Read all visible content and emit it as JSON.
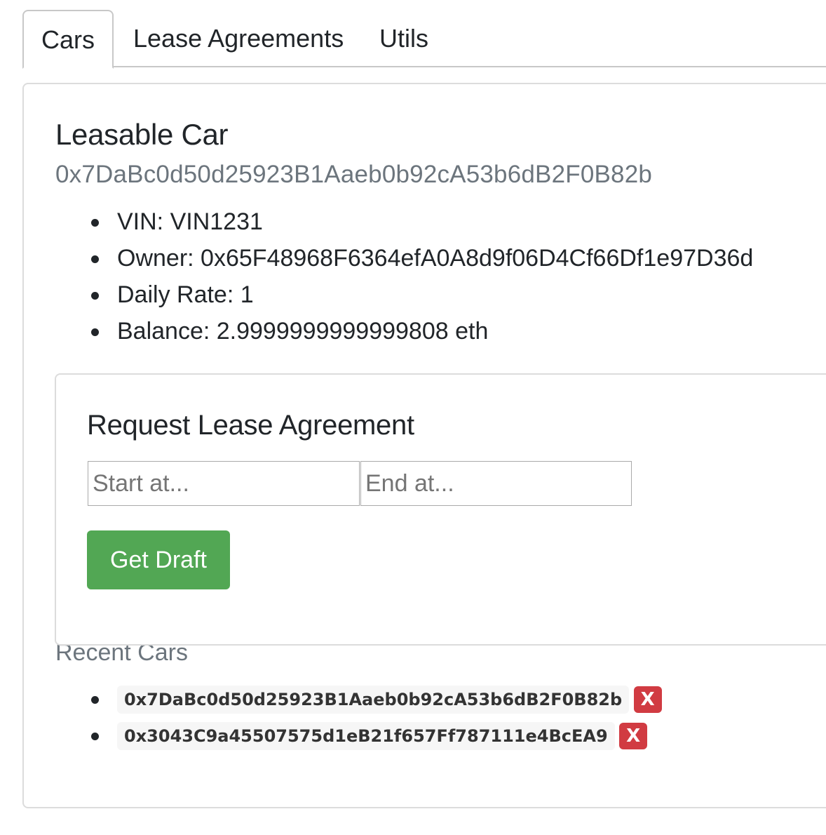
{
  "tabs": [
    {
      "label": "Cars",
      "active": true
    },
    {
      "label": "Lease Agreements",
      "active": false
    },
    {
      "label": "Utils",
      "active": false
    }
  ],
  "car": {
    "heading": "Leasable Car",
    "address": "0x7DaBc0d50d25923B1Aaeb0b92cA53b6dB2F0B82b",
    "properties": [
      "VIN: VIN1231",
      "Owner: 0x65F48968F6364efA0A8d9f06D4Cf66Df1e97D36d",
      "Daily Rate: 1",
      "Balance: 2.9999999999999808 eth"
    ]
  },
  "lease_request": {
    "heading": "Request Lease Agreement",
    "start_placeholder": "Start at...",
    "start_value": "",
    "end_placeholder": "End at...",
    "end_value": "",
    "submit_label": "Get Draft",
    "submit_color": "#52a754"
  },
  "recent": {
    "heading": "Recent Cars",
    "items": [
      {
        "address": "0x7DaBc0d50d25923B1Aaeb0b92cA53b6dB2F0B82b",
        "remove_label": "X"
      },
      {
        "address": "0x3043C9a45507575d1eB21f657Ff787111e4BcEA9",
        "remove_label": "X"
      }
    ],
    "remove_color": "#d13b42"
  }
}
